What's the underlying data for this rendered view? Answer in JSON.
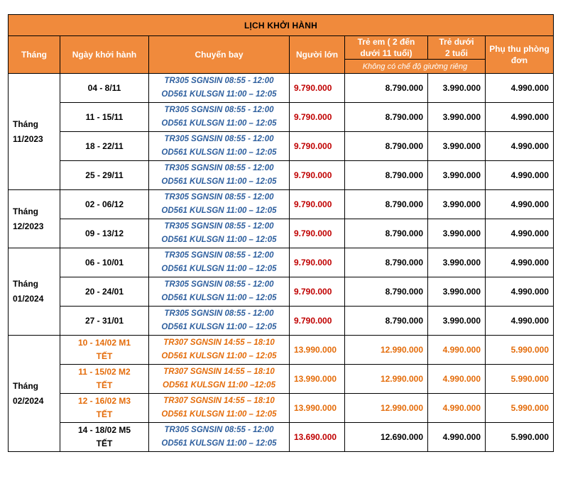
{
  "title": "LỊCH KHỞI HÀNH",
  "headers": {
    "month": "Tháng",
    "date": "Ngày  khởi hành",
    "flight": "Chuyến bay",
    "adult": "Người lớn",
    "child_line1": "Trẻ em ( 2 đến",
    "child_line2": "dưới 11 tuổi)",
    "child_note": "Không có chế độ giường riêng",
    "infant_line1": "Trẻ dưới",
    "infant_line2": "2 tuổi",
    "single_line1": "Phụ thu phòng",
    "single_line2": "đơn"
  },
  "groups": [
    {
      "month_line1": "Tháng",
      "month_line2": "11/2023",
      "rows": [
        {
          "date_line1": "04  - 8/11",
          "date_line2": "",
          "flight1": "TR305 SGNSIN 08:55 - 12:00",
          "flight2": "OD561 KULSGN 11:00 – 12:05",
          "adult": "9.790.000",
          "child": "8.790.000",
          "infant": "3.990.000",
          "single": "4.990.000"
        },
        {
          "date_line1": "11 - 15/11",
          "date_line2": "",
          "flight1": "TR305 SGNSIN 08:55 - 12:00",
          "flight2": "OD561 KULSGN 11:00 – 12:05",
          "adult": "9.790.000",
          "child": "8.790.000",
          "infant": "3.990.000",
          "single": "4.990.000"
        },
        {
          "date_line1": "18 - 22/11",
          "date_line2": "",
          "flight1": "TR305 SGNSIN 08:55 - 12:00",
          "flight2": "OD561 KULSGN 11:00 – 12:05",
          "adult": "9.790.000",
          "child": "8.790.000",
          "infant": "3.990.000",
          "single": "4.990.000"
        },
        {
          "date_line1": "25 - 29/11",
          "date_line2": "",
          "flight1": "TR305 SGNSIN 08:55 - 12:00",
          "flight2": "OD561 KULSGN 11:00 – 12:05",
          "adult": "9.790.000",
          "child": "8.790.000",
          "infant": "3.990.000",
          "single": "4.990.000"
        }
      ]
    },
    {
      "month_line1": "Tháng",
      "month_line2": "12/2023",
      "rows": [
        {
          "date_line1": "02 - 06/12",
          "date_line2": "",
          "flight1": "TR305 SGNSIN 08:55 - 12:00",
          "flight2": "OD561 KULSGN 11:00 – 12:05",
          "adult": "9.790.000",
          "child": "8.790.000",
          "infant": "3.990.000",
          "single": "4.990.000"
        },
        {
          "date_line1": "09 - 13/12",
          "date_line2": "",
          "flight1": "TR305 SGNSIN 08:55 - 12:00",
          "flight2": "OD561 KULSGN 11:00 – 12:05",
          "adult": "9.790.000",
          "child": "8.790.000",
          "infant": "3.990.000",
          "single": "4.990.000"
        }
      ]
    },
    {
      "month_line1": "Tháng",
      "month_line2": "01/2024",
      "rows": [
        {
          "date_line1": "06 - 10/01",
          "date_line2": "",
          "flight1": "TR305 SGNSIN 08:55 - 12:00",
          "flight2": "OD561 KULSGN 11:00 – 12:05",
          "adult": "9.790.000",
          "child": "8.790.000",
          "infant": "3.990.000",
          "single": "4.990.000"
        },
        {
          "date_line1": "20 - 24/01",
          "date_line2": "",
          "flight1": "TR305 SGNSIN 08:55 - 12:00",
          "flight2": "OD561 KULSGN 11:00 – 12:05",
          "adult": "9.790.000",
          "child": "8.790.000",
          "infant": "3.990.000",
          "single": "4.990.000"
        },
        {
          "date_line1": "27 - 31/01",
          "date_line2": "",
          "flight1": "TR305 SGNSIN 08:55 - 12:00",
          "flight2": "OD561 KULSGN 11:00 – 12:05",
          "adult": "9.790.000",
          "child": "8.790.000",
          "infant": "3.990.000",
          "single": "4.990.000"
        }
      ]
    },
    {
      "month_line1": "Tháng",
      "month_line2": "02/2024",
      "rows": [
        {
          "date_line1": "10 - 14/02 M1",
          "date_line2": "TẾT",
          "flight1": "TR307 SGNSIN 14:55 – 18:10",
          "flight2": "OD561 KULSGN 11:00 – 12:05",
          "adult": "13.990.000",
          "child": "12.990.000",
          "infant": "4.990.000",
          "single": "5.990.000"
        },
        {
          "date_line1": "11 - 15/02 M2",
          "date_line2": "TẾT",
          "flight1": "TR307 SGNSIN 14:55 – 18:10",
          "flight2": "OD561 KULSGN 11:00 –12:05",
          "adult": "13.990.000",
          "child": "12.990.000",
          "infant": "4.990.000",
          "single": "5.990.000"
        },
        {
          "date_line1": "12 - 16/02 M3",
          "date_line2": "TẾT",
          "flight1": "TR307 SGNSIN 14:55 – 18:10",
          "flight2": "OD561 KULSGN 11:00 – 12:05",
          "adult": "13.990.000",
          "child": "12.990.000",
          "infant": "4.990.000",
          "single": "5.990.000"
        },
        {
          "date_line1": "14 - 18/02 M5",
          "date_line2": "TẾT",
          "flight1": "TR305 SGNSIN 08:55 - 12:00",
          "flight2": "OD561 KULSGN 11:00 – 12:05",
          "adult": "13.690.000",
          "child": "12.690.000",
          "infant": "4.990.000",
          "single": "5.990.000"
        }
      ]
    }
  ]
}
